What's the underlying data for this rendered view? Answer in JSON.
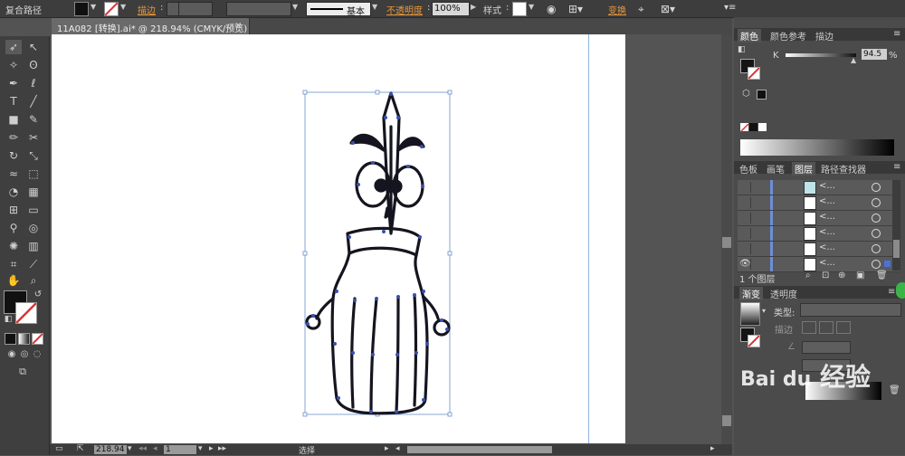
{
  "control_bar": {
    "object_type": "复合路径",
    "stroke_label": "描边",
    "stroke_style": "基本",
    "opacity_label": "不透明度",
    "opacity_value": "100%",
    "style_label": "样式",
    "transform_label": "变换"
  },
  "document": {
    "tab_title": "11A082 [转换].ai* @ 218.94% (CMYK/预览)",
    "close_glyph": "×"
  },
  "status_bar": {
    "zoom": "218.94",
    "artboard_num": "1",
    "tool_status": "选择"
  },
  "color_panel": {
    "tabs": [
      "颜色",
      "颜色参考",
      "描边"
    ],
    "channel_label": "K",
    "k_value": "94.5",
    "k_unit": "%"
  },
  "layers_panel": {
    "tabs": [
      "色板",
      "画笔",
      "图层",
      "路径查找器"
    ],
    "rows": [
      {
        "name": "<...",
        "eye": false
      },
      {
        "name": "<...",
        "eye": false
      },
      {
        "name": "<...",
        "eye": false
      },
      {
        "name": "<...",
        "eye": false
      },
      {
        "name": "<...",
        "eye": false
      },
      {
        "name": "<...",
        "eye": true
      }
    ],
    "footer": "1 个图层"
  },
  "gradient_panel": {
    "tabs": [
      "渐变",
      "透明度"
    ],
    "type_label": "类型:",
    "stroke_label": "描边"
  },
  "watermark": {
    "text": "经验",
    "logo": "Bai du"
  },
  "colors": {
    "accent_orange": "#e8973a",
    "path_selection": "#2a3a8c",
    "layer_bar": "#6d8fd6"
  }
}
